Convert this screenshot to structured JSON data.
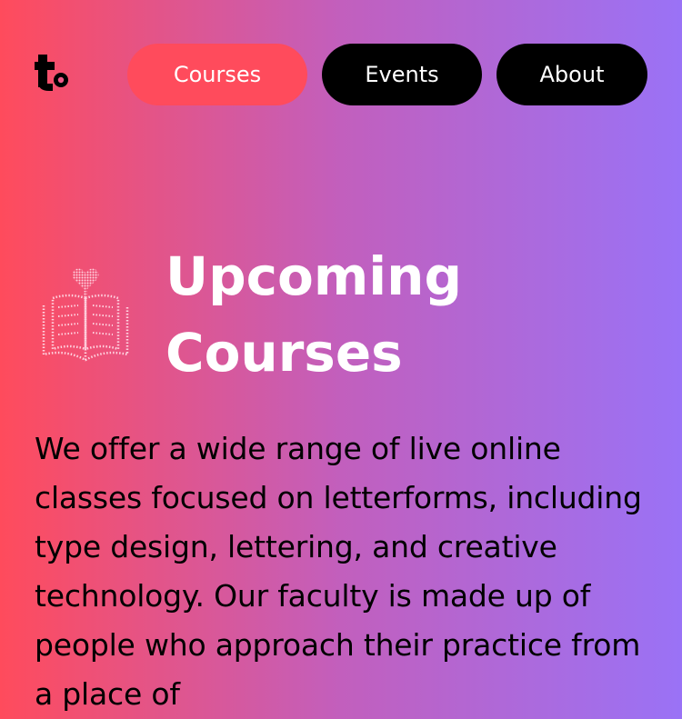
{
  "nav": {
    "courses_label": "Courses",
    "events_label": "Events",
    "about_label": "About"
  },
  "main": {
    "title_line1": "Upcoming",
    "title_line2": "Courses",
    "intro_text": "We offer a wide range of live online classes focused on letterforms, including type design, lettering, and creative technology. Our faculty is made up of people who approach their practice from a place of"
  },
  "icons": {
    "logo": "logo-t-icon",
    "book": "book-heart-icon"
  },
  "colors": {
    "gradient_start": "#ff4b5c",
    "gradient_mid": "#c25fbd",
    "gradient_end": "#9a72f6",
    "active_nav": "#ff4b5c",
    "nav_bg": "#000000",
    "text_light": "#ffffff",
    "text_dark": "#000000"
  }
}
